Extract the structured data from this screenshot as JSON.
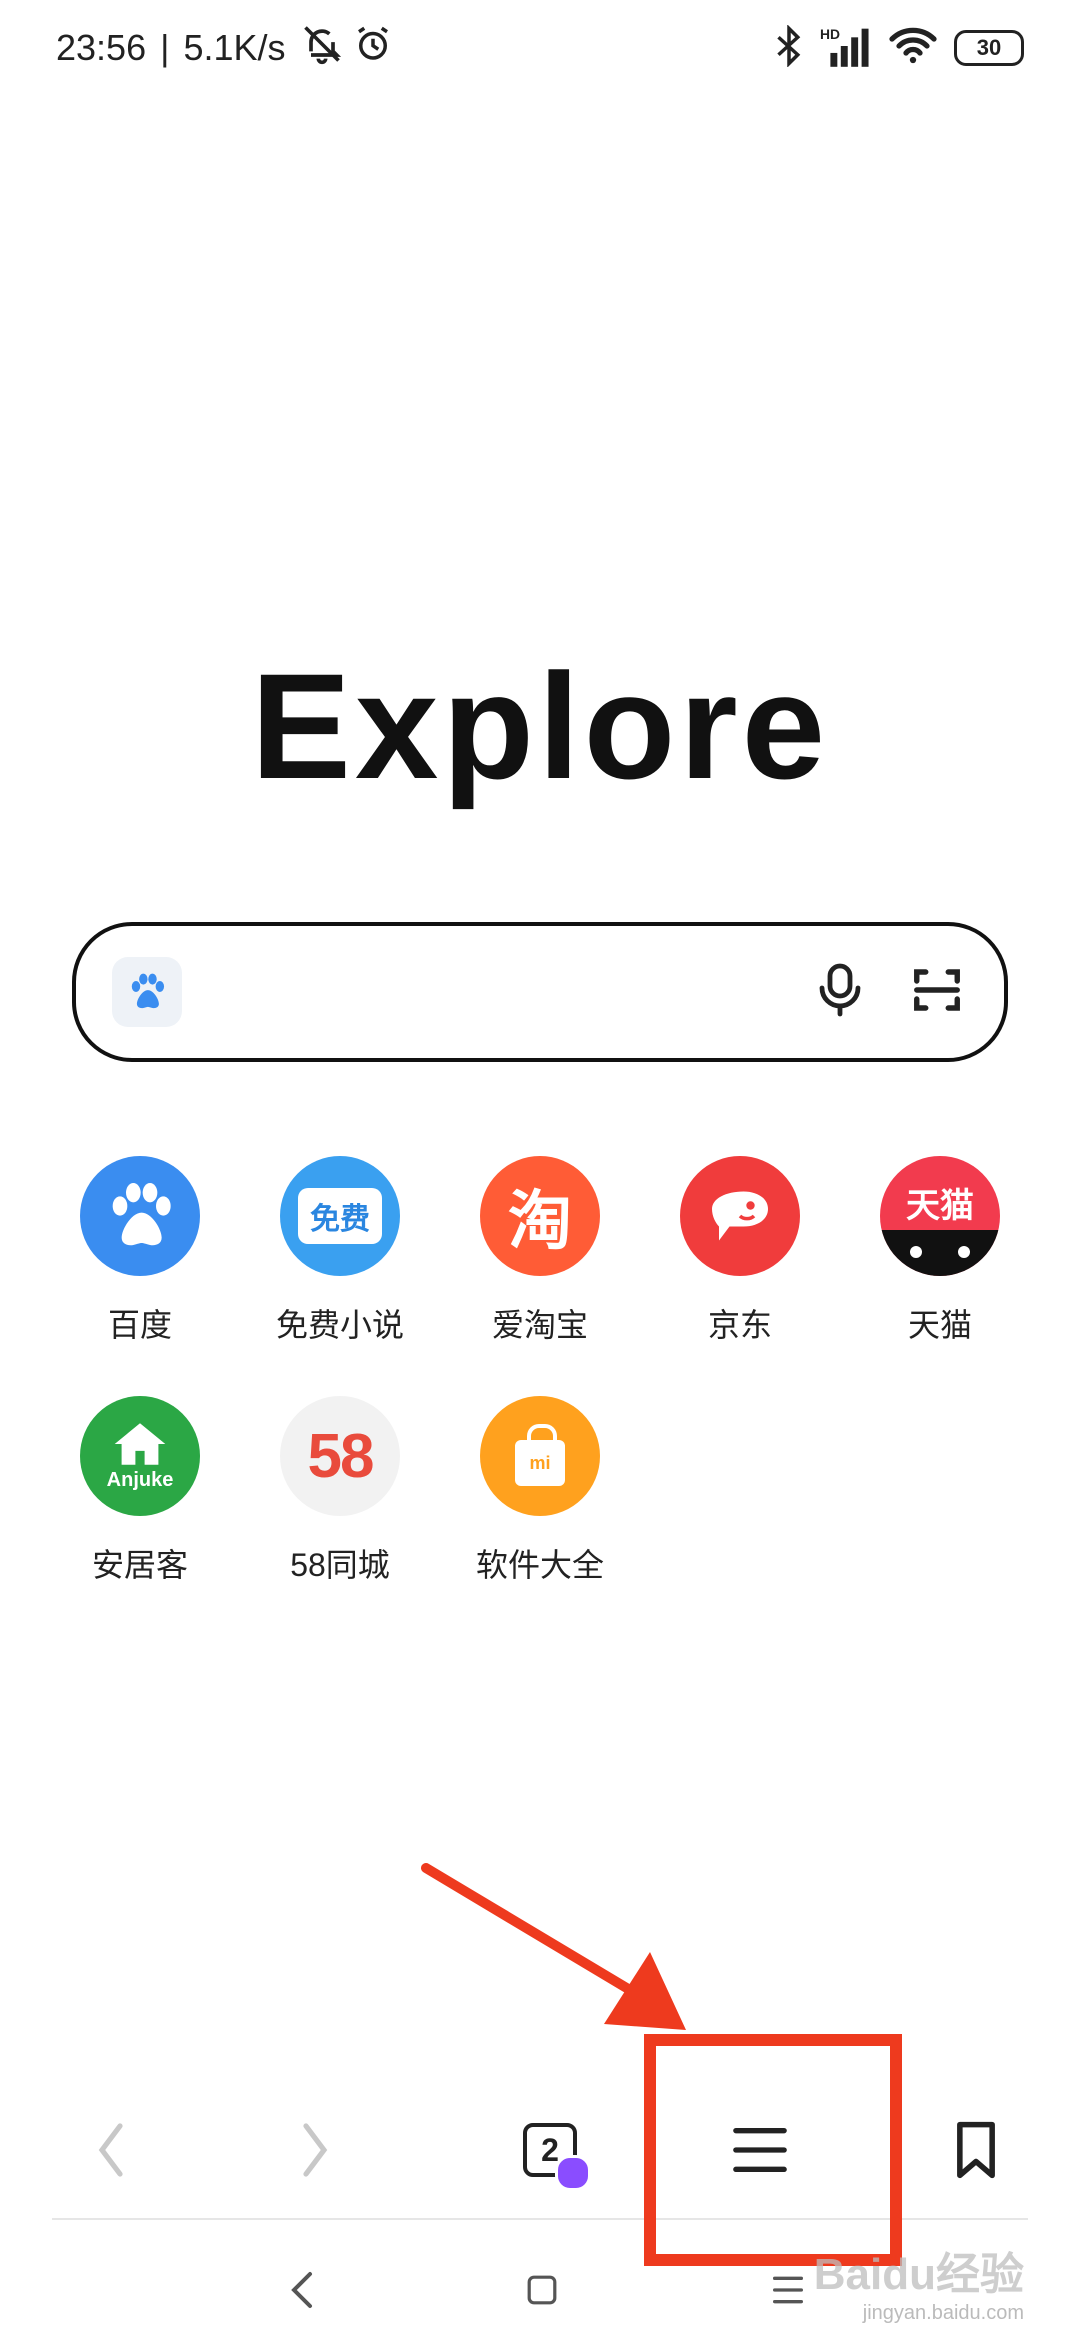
{
  "status_bar": {
    "time": "23:56",
    "separator": "|",
    "net_speed": "5.1K/s",
    "battery": "30",
    "icons": [
      "bell-off-icon",
      "alarm-icon",
      "bluetooth-icon",
      "hd-signal-icon",
      "wifi-icon",
      "battery-icon"
    ]
  },
  "logo_text": "Explore",
  "search": {
    "placeholder": "",
    "value": ""
  },
  "shortcuts": [
    {
      "label": "百度",
      "color": "#3a8df0"
    },
    {
      "label": "免费小说",
      "color": "#3aa0f0"
    },
    {
      "label": "爱淘宝",
      "color": "#ff5c36"
    },
    {
      "label": "京东",
      "color": "#f03c3c"
    },
    {
      "label": "天猫",
      "color": "#f23b4e"
    },
    {
      "label": "安居客",
      "color": "#2ba745"
    },
    {
      "label": "58同城",
      "color": "#f2f2f2"
    },
    {
      "label": "软件大全",
      "color": "#ffa11e"
    }
  ],
  "shortcut_icon_text": {
    "novel": "免费",
    "taobao": "淘",
    "tmall": "天猫",
    "anjuke": "Anjuke",
    "five_eight": "58",
    "apps": "mi"
  },
  "toolbar": {
    "tab_count": "2"
  },
  "watermark": {
    "brand": "Baidu",
    "brand_suffix": "经验",
    "url": "jingyan.baidu.com"
  },
  "colors": {
    "annotation": "#ee3a1e",
    "accent_purple": "#8a4dff"
  }
}
